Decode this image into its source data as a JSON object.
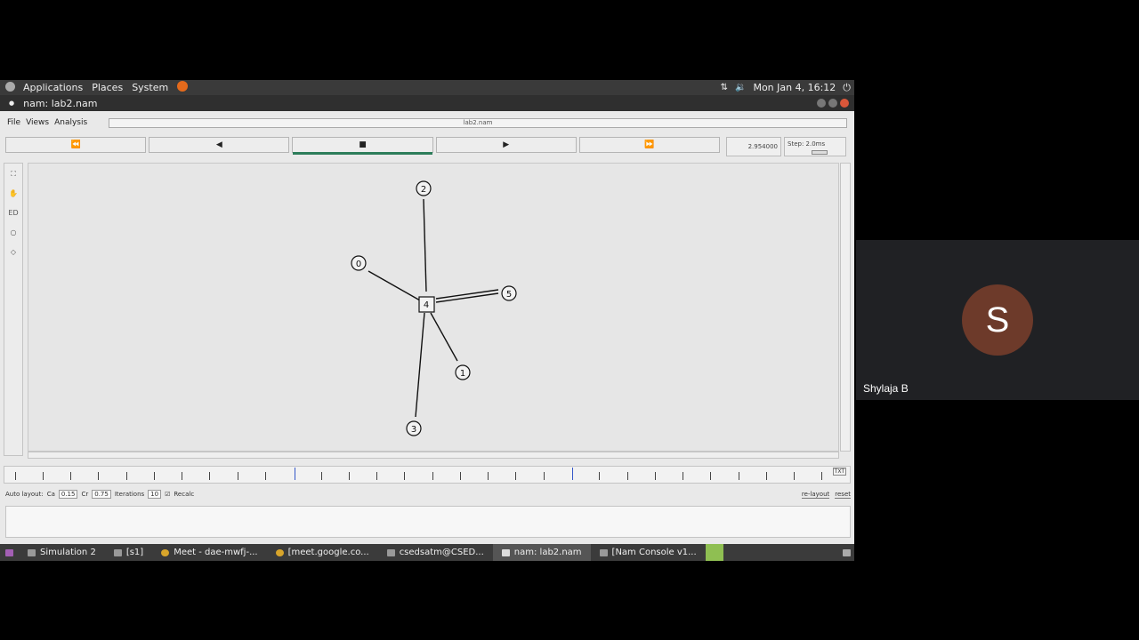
{
  "topbar": {
    "menus": [
      "Applications",
      "Places",
      "System"
    ],
    "datetime": "Mon Jan 4, 16:12"
  },
  "window": {
    "title": "nam: lab2.nam"
  },
  "nam": {
    "menu": [
      "File",
      "Views",
      "Analysis"
    ],
    "filename": "lab2.nam",
    "controls": [
      "⏪",
      "◀",
      "■",
      "▶",
      "⏩"
    ],
    "time": "2.954000",
    "step": "Step: 2.0ms",
    "tools": [
      "⛶",
      "✋",
      "ED",
      "○",
      "◇"
    ],
    "nodes": [
      {
        "label": "0",
        "shape": "circle"
      },
      {
        "label": "1",
        "shape": "circle"
      },
      {
        "label": "2",
        "shape": "circle"
      },
      {
        "label": "3",
        "shape": "circle"
      },
      {
        "label": "4",
        "shape": "square"
      },
      {
        "label": "5",
        "shape": "circle"
      }
    ],
    "timeline_tag": "TXT",
    "autolayout": {
      "label": "Auto layout:",
      "ca_label": "Ca",
      "ca": "0.15",
      "cr_label": "Cr",
      "cr": "0.75",
      "iter_label": "Iterations",
      "iter": "10",
      "recalc": "Recalc",
      "relayout": "re-layout",
      "reset": "reset"
    }
  },
  "taskbar": [
    "Simulation 2",
    "[s1]",
    "Meet - dae-mwfj-...",
    "[meet.google.co...",
    "csedsatm@CSED...",
    "nam: lab2.nam",
    "[Nam Console v1..."
  ],
  "participant": {
    "initial": "S",
    "name": "Shylaja B"
  }
}
